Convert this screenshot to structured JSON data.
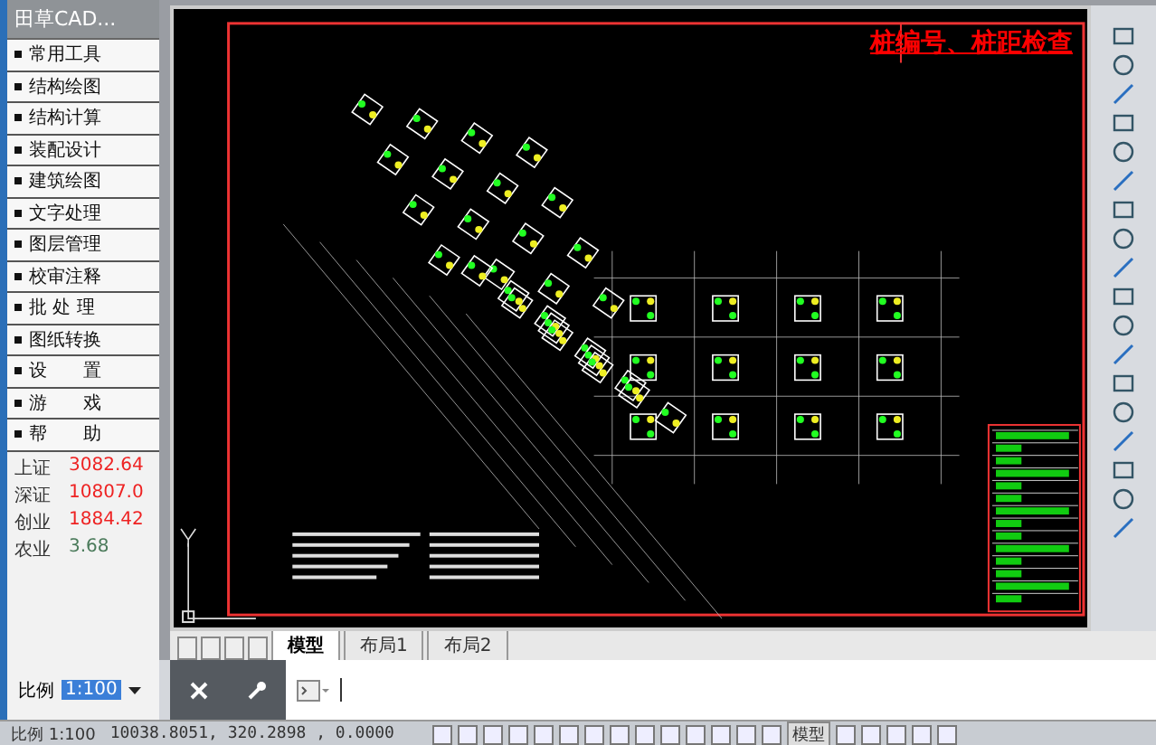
{
  "menu_panel": {
    "title": "田草CAD...",
    "items": [
      {
        "label": "常用工具"
      },
      {
        "label": "结构绘图"
      },
      {
        "label": "结构计算"
      },
      {
        "label": "装配设计"
      },
      {
        "label": "建筑绘图"
      },
      {
        "label": "文字处理"
      },
      {
        "label": "图层管理"
      },
      {
        "label": "校审注释"
      },
      {
        "label": "批 处 理"
      },
      {
        "label": "图纸转换"
      },
      {
        "label": "设　　置"
      },
      {
        "label": "游　　戏"
      },
      {
        "label": "帮　　助"
      }
    ]
  },
  "ticker": [
    {
      "name": "上证",
      "value": "3082.64"
    },
    {
      "name": "深证",
      "value": "10807.0"
    },
    {
      "name": "创业",
      "value": "1884.42"
    },
    {
      "name": "农业",
      "value": "3.68"
    }
  ],
  "scale_field": {
    "label": "比例",
    "value": "1:100"
  },
  "drawing": {
    "caption": "桩编号、桩距检查"
  },
  "layout_tabs": [
    {
      "label": "模型",
      "selected": true
    },
    {
      "label": "布局1",
      "selected": false
    },
    {
      "label": "布局2",
      "selected": false
    }
  ],
  "status_bar": {
    "scale": "比例 1:100",
    "coordinates": "10038.8051, 320.2898 , 0.0000",
    "model_button": "模型"
  }
}
